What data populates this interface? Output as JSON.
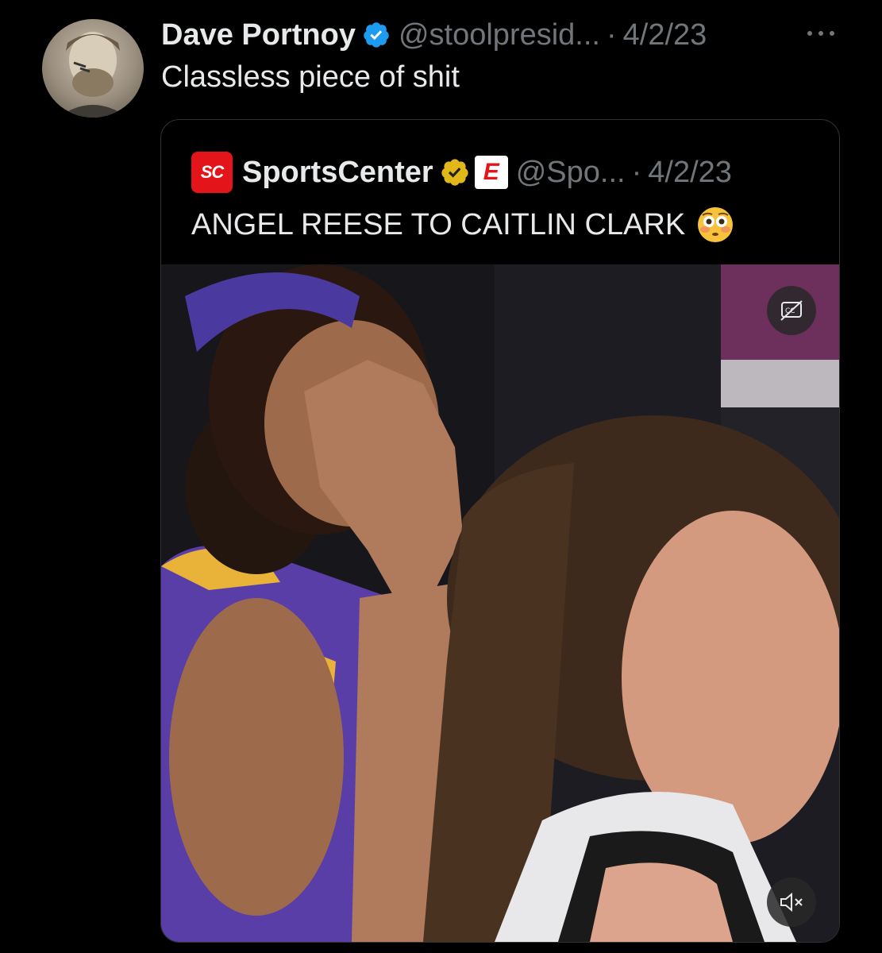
{
  "tweet": {
    "author_name": "Dave Portnoy",
    "handle": "@stoolpresid...",
    "separator": "·",
    "date": "4/2/23",
    "text": "Classless piece of shit"
  },
  "quoted_tweet": {
    "author_name": "SportsCenter",
    "logo_text": "SC",
    "affiliate_badge_text": "E",
    "handle": "@Spo...",
    "separator": "·",
    "date": "4/2/23",
    "text": "ANGEL REESE TO CAITLIN CLARK",
    "emoji": "flushed-face",
    "media": {
      "type": "video",
      "controls": [
        "cc-icon",
        "mute-icon"
      ]
    }
  },
  "colors": {
    "background": "#000000",
    "primary_text": "#e7e9ea",
    "secondary_text": "#71767b",
    "verified_blue": "#1d9bf0",
    "verified_gold": "#e2b719",
    "espn_red": "#e3151a",
    "border": "#2f3336"
  }
}
